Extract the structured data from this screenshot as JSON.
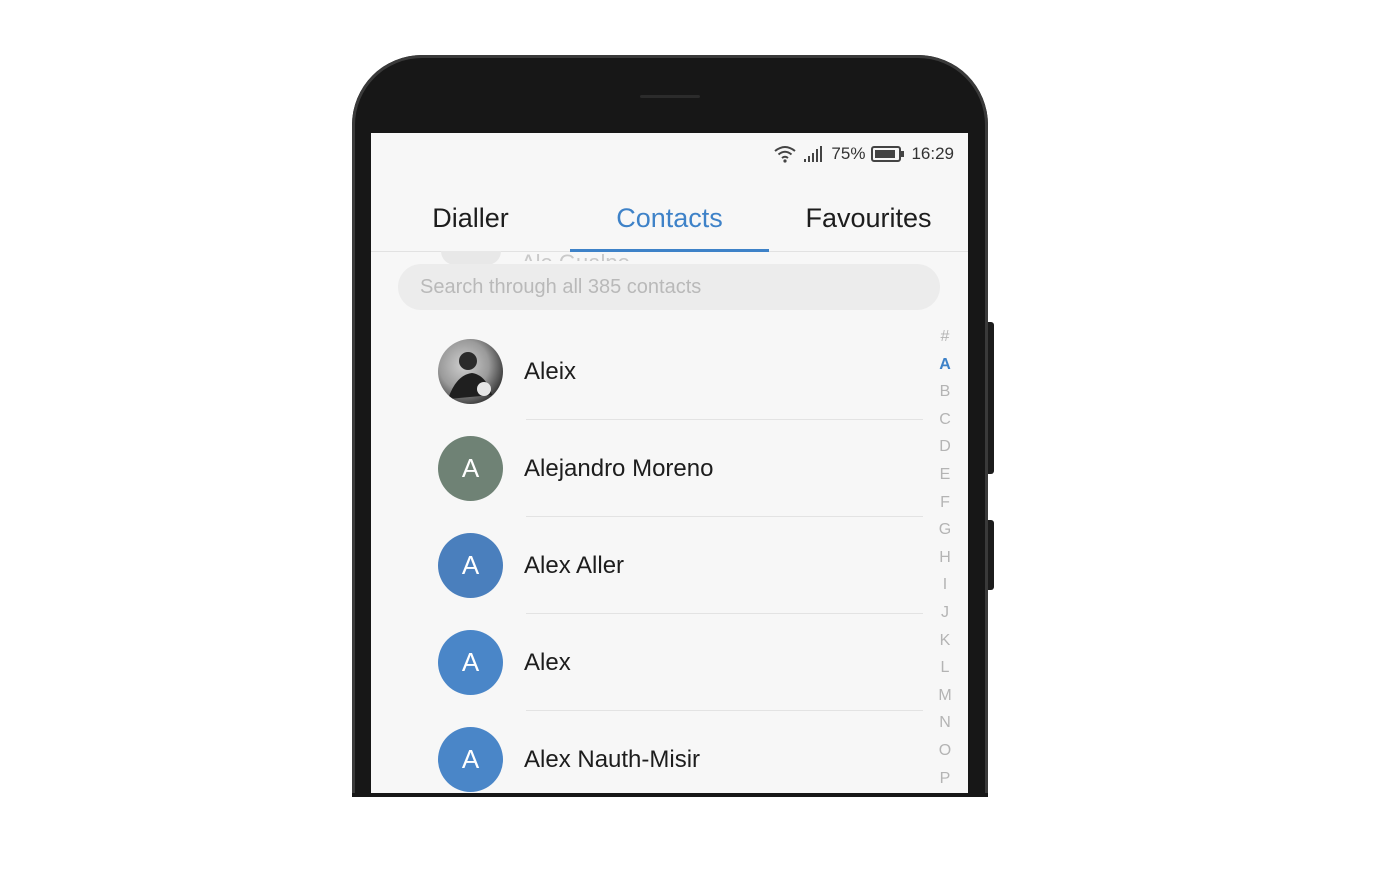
{
  "status_bar": {
    "battery_percent": "75%",
    "time": "16:29"
  },
  "tabs": [
    {
      "label": "Dialler",
      "active": false
    },
    {
      "label": "Contacts",
      "active": true
    },
    {
      "label": "Favourites",
      "active": false
    }
  ],
  "ghost_contact": "Ale Gualpo",
  "search": {
    "placeholder": "Search through all 385 contacts",
    "value": ""
  },
  "contacts": [
    {
      "name": "Aleix",
      "initial": "",
      "avatar_type": "photo",
      "color": ""
    },
    {
      "name": "Alejandro Moreno",
      "initial": "A",
      "avatar_type": "initial",
      "color": "#6f8275"
    },
    {
      "name": "Alex Aller",
      "initial": "A",
      "avatar_type": "initial",
      "color": "#4a7fbd"
    },
    {
      "name": "Alex",
      "initial": "A",
      "avatar_type": "initial",
      "color": "#4a86c8"
    },
    {
      "name": "Alex Nauth-Misir",
      "initial": "A",
      "avatar_type": "initial",
      "color": "#4a86c8"
    }
  ],
  "alphabet_index": [
    "#",
    "A",
    "B",
    "C",
    "D",
    "E",
    "F",
    "G",
    "H",
    "I",
    "J",
    "K",
    "L",
    "M",
    "N",
    "O",
    "P"
  ],
  "alphabet_current": "A",
  "colors": {
    "accent": "#3e82c8",
    "frame": "#171717"
  }
}
